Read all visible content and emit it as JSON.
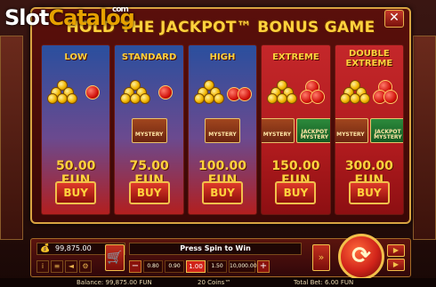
{
  "watermark": {
    "main": "Slot",
    "accent": "Catalog",
    "sup": "com"
  },
  "modal": {
    "title": "HOLD THE JACKPOT™ BONUS GAME",
    "close_label": "✕"
  },
  "options": [
    {
      "name": "LOW",
      "price": "50.00 FUN",
      "buy_label": "BUY",
      "red_gems": 1,
      "mystery": []
    },
    {
      "name": "STANDARD",
      "price": "75.00 FUN",
      "buy_label": "BUY",
      "red_gems": 1,
      "mystery": [
        "MYSTERY"
      ]
    },
    {
      "name": "HIGH",
      "price": "100.00 FUN",
      "buy_label": "BUY",
      "red_gems": 2,
      "mystery": [
        "MYSTERY"
      ]
    },
    {
      "name": "EXTREME",
      "price": "150.00 FUN",
      "buy_label": "BUY",
      "red_gems": 3,
      "mystery": [
        "MYSTERY",
        "JACKPOT MYSTERY"
      ]
    },
    {
      "name": "DOUBLE EXTREME",
      "price": "300.00 FUN",
      "buy_label": "BUY",
      "red_gems": 3,
      "mystery": [
        "MYSTERY",
        "JACKPOT MYSTERY"
      ]
    }
  ],
  "panel": {
    "balance": "99,875.00",
    "status": "Press Spin to Win",
    "bets": [
      "−",
      "0.80",
      "0.90",
      "1.00",
      "1.50",
      "10,000.00",
      "+"
    ],
    "selected_bet": "1.00"
  },
  "footer": {
    "balance": "Balance: 99,875.00 FUN",
    "coins": "20 Coins™",
    "total_bet": "Total Bet: 6.00 FUN"
  },
  "colors": {
    "gold": "#ffd23d",
    "red": "#c4272a",
    "border": "#d9a441"
  }
}
